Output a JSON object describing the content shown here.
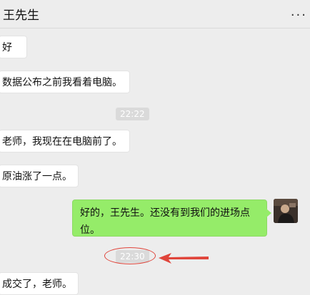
{
  "chat": {
    "title": "王先生",
    "more_label": "...",
    "messages": [
      {
        "text": "好"
      },
      {
        "text": "数据公布之前我看着电脑。"
      },
      {
        "text": "老师，我现在在电脑前了。"
      },
      {
        "text": "原油涨了一点。"
      },
      {
        "text": "好的，王先生。还没有到我们的进场点位。"
      },
      {
        "text": "成交了，老师。"
      }
    ],
    "timestamps": [
      "22:22",
      "22:30"
    ]
  },
  "colors": {
    "sent_bubble": "#95ec69",
    "received_bubble": "#ffffff",
    "annotation": "#e0453b"
  },
  "icons": {
    "more": "more-dots-icon",
    "avatar": "avatar"
  }
}
